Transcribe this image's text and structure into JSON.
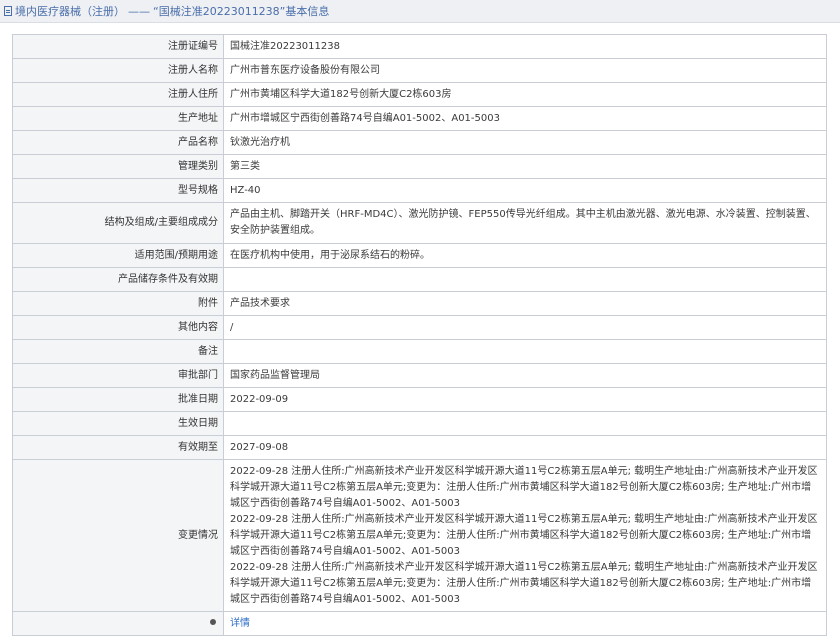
{
  "header": {
    "icon": "document-icon",
    "breadcrumb_section": "境内医疗器械（注册）",
    "separator": "——",
    "title": "“国械注准20223011238”基本信息"
  },
  "rows": [
    {
      "label": "注册证编号",
      "value": "国械注准20223011238"
    },
    {
      "label": "注册人名称",
      "value": "广州市普东医疗设备股份有限公司"
    },
    {
      "label": "注册人住所",
      "value": "广州市黄埔区科学大道182号创新大厦C2栋603房"
    },
    {
      "label": "生产地址",
      "value": "广州市增城区宁西街创善路74号自编A01-5002、A01-5003"
    },
    {
      "label": "产品名称",
      "value": "钬激光治疗机"
    },
    {
      "label": "管理类别",
      "value": "第三类"
    },
    {
      "label": "型号规格",
      "value": "HZ-40"
    },
    {
      "label": "结构及组成/主要组成成分",
      "value": "产品由主机、脚踏开关（HRF-MD4C）、激光防护镜、FEP550传导光纤组成。其中主机由激光器、激光电源、水冷装置、控制装置、安全防护装置组成。"
    },
    {
      "label": "适用范围/预期用途",
      "value": "在医疗机构中使用，用于泌尿系结石的粉碎。"
    },
    {
      "label": "产品储存条件及有效期",
      "value": ""
    },
    {
      "label": "附件",
      "value": "产品技术要求"
    },
    {
      "label": "其他内容",
      "value": "/"
    },
    {
      "label": "备注",
      "value": ""
    },
    {
      "label": "审批部门",
      "value": "国家药品监督管理局"
    },
    {
      "label": "批准日期",
      "value": "2022-09-09"
    },
    {
      "label": "生效日期",
      "value": ""
    },
    {
      "label": "有效期至",
      "value": "2027-09-08"
    }
  ],
  "changes": {
    "label": "变更情况",
    "entries": [
      "2022-09-28 注册人住所:广州高新技术产业开发区科学城开源大道11号C2栋第五层A单元; 载明生产地址由:广州高新技术产业开发区科学城开源大道11号C2栋第五层A单元;变更为：注册人住所:广州市黄埔区科学大道182号创新大厦C2栋603房; 生产地址:广州市增城区宁西街创善路74号自编A01-5002、A01-5003",
      "2022-09-28 注册人住所:广州高新技术产业开发区科学城开源大道11号C2栋第五层A单元; 载明生产地址由:广州高新技术产业开发区科学城开源大道11号C2栋第五层A单元;变更为：注册人住所:广州市黄埔区科学大道182号创新大厦C2栋603房; 生产地址:广州市增城区宁西街创善路74号自编A01-5002、A01-5003",
      "2022-09-28 注册人住所:广州高新技术产业开发区科学城开源大道11号C2栋第五层A单元; 载明生产地址由:广州高新技术产业开发区科学城开源大道11号C2栋第五层A单元;变更为：注册人住所:广州市黄埔区科学大道182号创新大厦C2栋603房; 生产地址:广州市增城区宁西街创善路74号自编A01-5002、A01-5003"
    ]
  },
  "footer_row": {
    "label_icon": "pin-icon",
    "link_text": "详情"
  }
}
